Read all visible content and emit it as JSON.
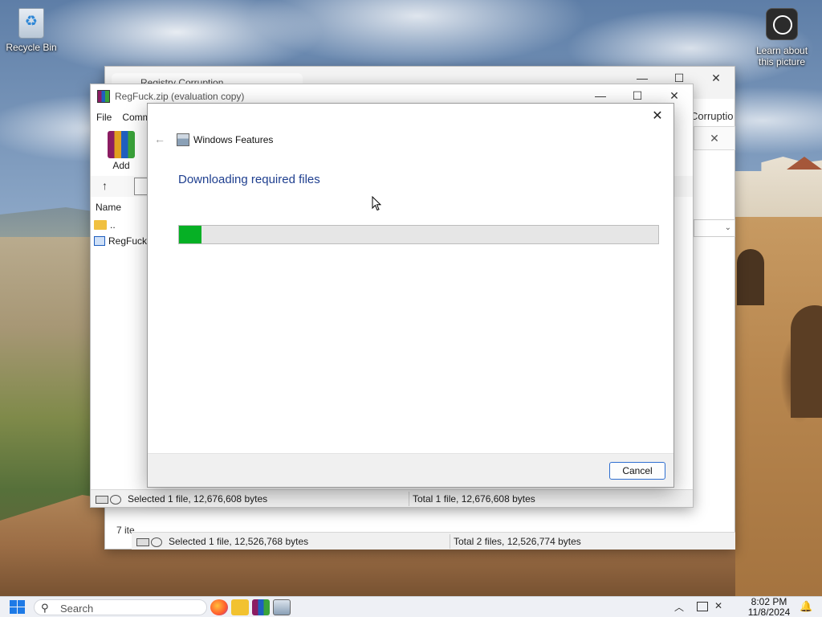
{
  "desktop": {
    "recycle_bin_label": "Recycle Bin",
    "learn_label_line1": "Learn about",
    "learn_label_line2": "this picture"
  },
  "back_window": {
    "tab_title": "Registry Corruption",
    "side_label": "Corruptio",
    "items_count": "7 ite",
    "status_selected": "Selected 1 file, 12,526,768 bytes",
    "status_total": "Total 2 files, 12,526,774 bytes"
  },
  "winrar": {
    "title": "RegFuck.zip (evaluation copy)",
    "menu": [
      "File",
      "Comm"
    ],
    "add_label": "Add",
    "column_name": "Name",
    "row_up": "..",
    "row_file": "RegFuck.",
    "status_selected": "Selected 1 file, 12,676,608 bytes",
    "status_total": "Total 1 file, 12,676,608 bytes"
  },
  "dialog": {
    "title": "Windows Features",
    "heading": "Downloading required files",
    "progress_fraction": 0.047,
    "cancel_label": "Cancel",
    "accent_color": "#06b025"
  },
  "taskbar": {
    "search_placeholder": "Search",
    "time": "8:02 PM",
    "date": "11/8/2024",
    "apps": [
      "firefox-icon",
      "file-explorer-icon",
      "winrar-icon",
      "windows-features-icon"
    ]
  }
}
